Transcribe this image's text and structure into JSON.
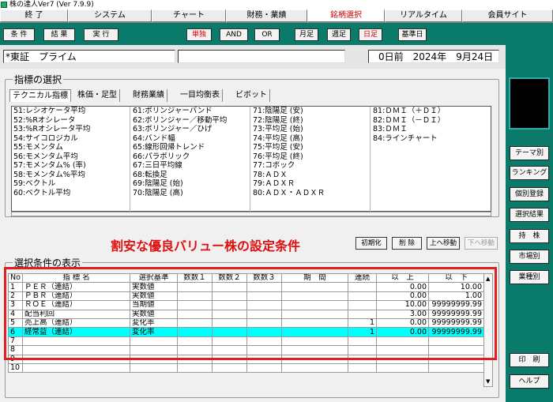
{
  "window": {
    "title": "株の達人Ver7 (Ver 7.9.9)"
  },
  "menubar": {
    "items": [
      "終 了",
      "システム",
      "チャート",
      "財務・業績",
      "銘柄選択",
      "リアルタイム",
      "会員サイト"
    ],
    "selected": "銘柄選択"
  },
  "toolbar": {
    "buttons": [
      "条 件",
      "結 果",
      "実 行"
    ],
    "modes": [
      "単独",
      "AND",
      "OR"
    ],
    "periods": [
      "月足",
      "週足",
      "日足"
    ],
    "base_date": "基準日"
  },
  "topbar": {
    "market": "*東証　プライム",
    "days_before": "0日前",
    "date": "2024年　9月24日"
  },
  "indicator_section": {
    "title": "指標の選択",
    "tabs": [
      "テクニカル指標",
      "株価・足型",
      "財務業績",
      "一目均衡表",
      "ビボット"
    ],
    "columns": [
      [
        "51:レシオケータ平均",
        "52:%Rオシレータ",
        "53:%Rオシレータ平均",
        "54:サイコロジカル",
        "55:モメンタム",
        "56:モメンタム平均",
        "57:モメンタム% (率)",
        "58:モメンタム%平均",
        "59:ベクトル",
        "60:ベクトル平均"
      ],
      [
        "61:ボリンジャーバンド",
        "62:ボリンジャー／移動平均",
        "63:ボリンジャー／ひげ",
        "64:バンド幅",
        "65:線形回帰トレンド",
        "66:パラボリック",
        "67:三日平均線",
        "68:転換足",
        "69:陰陽足 (始)",
        "70:陰陽足 (高)"
      ],
      [
        "71:陰陽足 (安)",
        "72:陰陽足 (終)",
        "73:平均足 (始)",
        "74:平均足 (高)",
        "75:平均足 (安)",
        "76:平均足 (終)",
        "77:コポック",
        "78:ＡＤＸ",
        "79:ＡＤＸＲ",
        "80:ＡＤＸ・ＡＤＸＲ"
      ],
      [
        "81:ＤＭＩ（＋ＤＩ）",
        "82:ＤＭＩ（－ＤＩ）",
        "83:ＤＭＩ",
        "84:ラインチャート",
        "",
        "",
        "",
        "",
        "",
        ""
      ]
    ]
  },
  "heading": "割安な優良バリュー株の設定条件",
  "condition_buttons": [
    "初期化",
    "削 除",
    "上へ移動",
    "下へ移動"
  ],
  "condition_section": {
    "title": "選択条件の表示",
    "headers": [
      "No",
      "指 標 名",
      "選択基準",
      "数数１",
      "数数２",
      "数数３",
      "期　間",
      "連続",
      "以　上",
      "以　下"
    ],
    "rows": [
      [
        "1",
        "ＰＥＲ（連結）",
        "実数値",
        "",
        "",
        "",
        "",
        "",
        "0.00",
        "10.00"
      ],
      [
        "2",
        "ＰＢＲ（連結）",
        "実数値",
        "",
        "",
        "",
        "",
        "",
        "0.00",
        "1.00"
      ],
      [
        "3",
        "ＲＯＥ（連結）",
        "当期値",
        "",
        "",
        "",
        "",
        "",
        "10.00",
        "99999999.99"
      ],
      [
        "4",
        "配当利回",
        "実数値",
        "",
        "",
        "",
        "",
        "",
        "3.00",
        "99999999.99"
      ],
      [
        "5",
        "売上高（連結）",
        "変化率",
        "",
        "",
        "",
        "",
        "1",
        "0.00",
        "99999999.99"
      ],
      [
        "6",
        "経常益（連結）",
        "変化率",
        "",
        "",
        "",
        "",
        "1",
        "0.00",
        "99999999.99"
      ],
      [
        "7",
        "",
        "",
        "",
        "",
        "",
        "",
        "",
        "",
        ""
      ],
      [
        "8",
        "",
        "",
        "",
        "",
        "",
        "",
        "",
        "",
        ""
      ],
      [
        "9",
        "",
        "",
        "",
        "",
        "",
        "",
        "",
        "",
        ""
      ],
      [
        "10",
        "",
        "",
        "",
        "",
        "",
        "",
        "",
        "",
        ""
      ]
    ],
    "highlight_row": 6
  },
  "right_panel": {
    "buttons": [
      "テーマ別",
      "ランキング",
      "個別登録",
      "選択結果",
      "持　株",
      "市場別",
      "業種別",
      "印　刷",
      "ヘルプ"
    ]
  },
  "colors": {
    "panel": "#0a7a6a",
    "highlight": "#00ffff",
    "accent_red": "#e01010"
  }
}
